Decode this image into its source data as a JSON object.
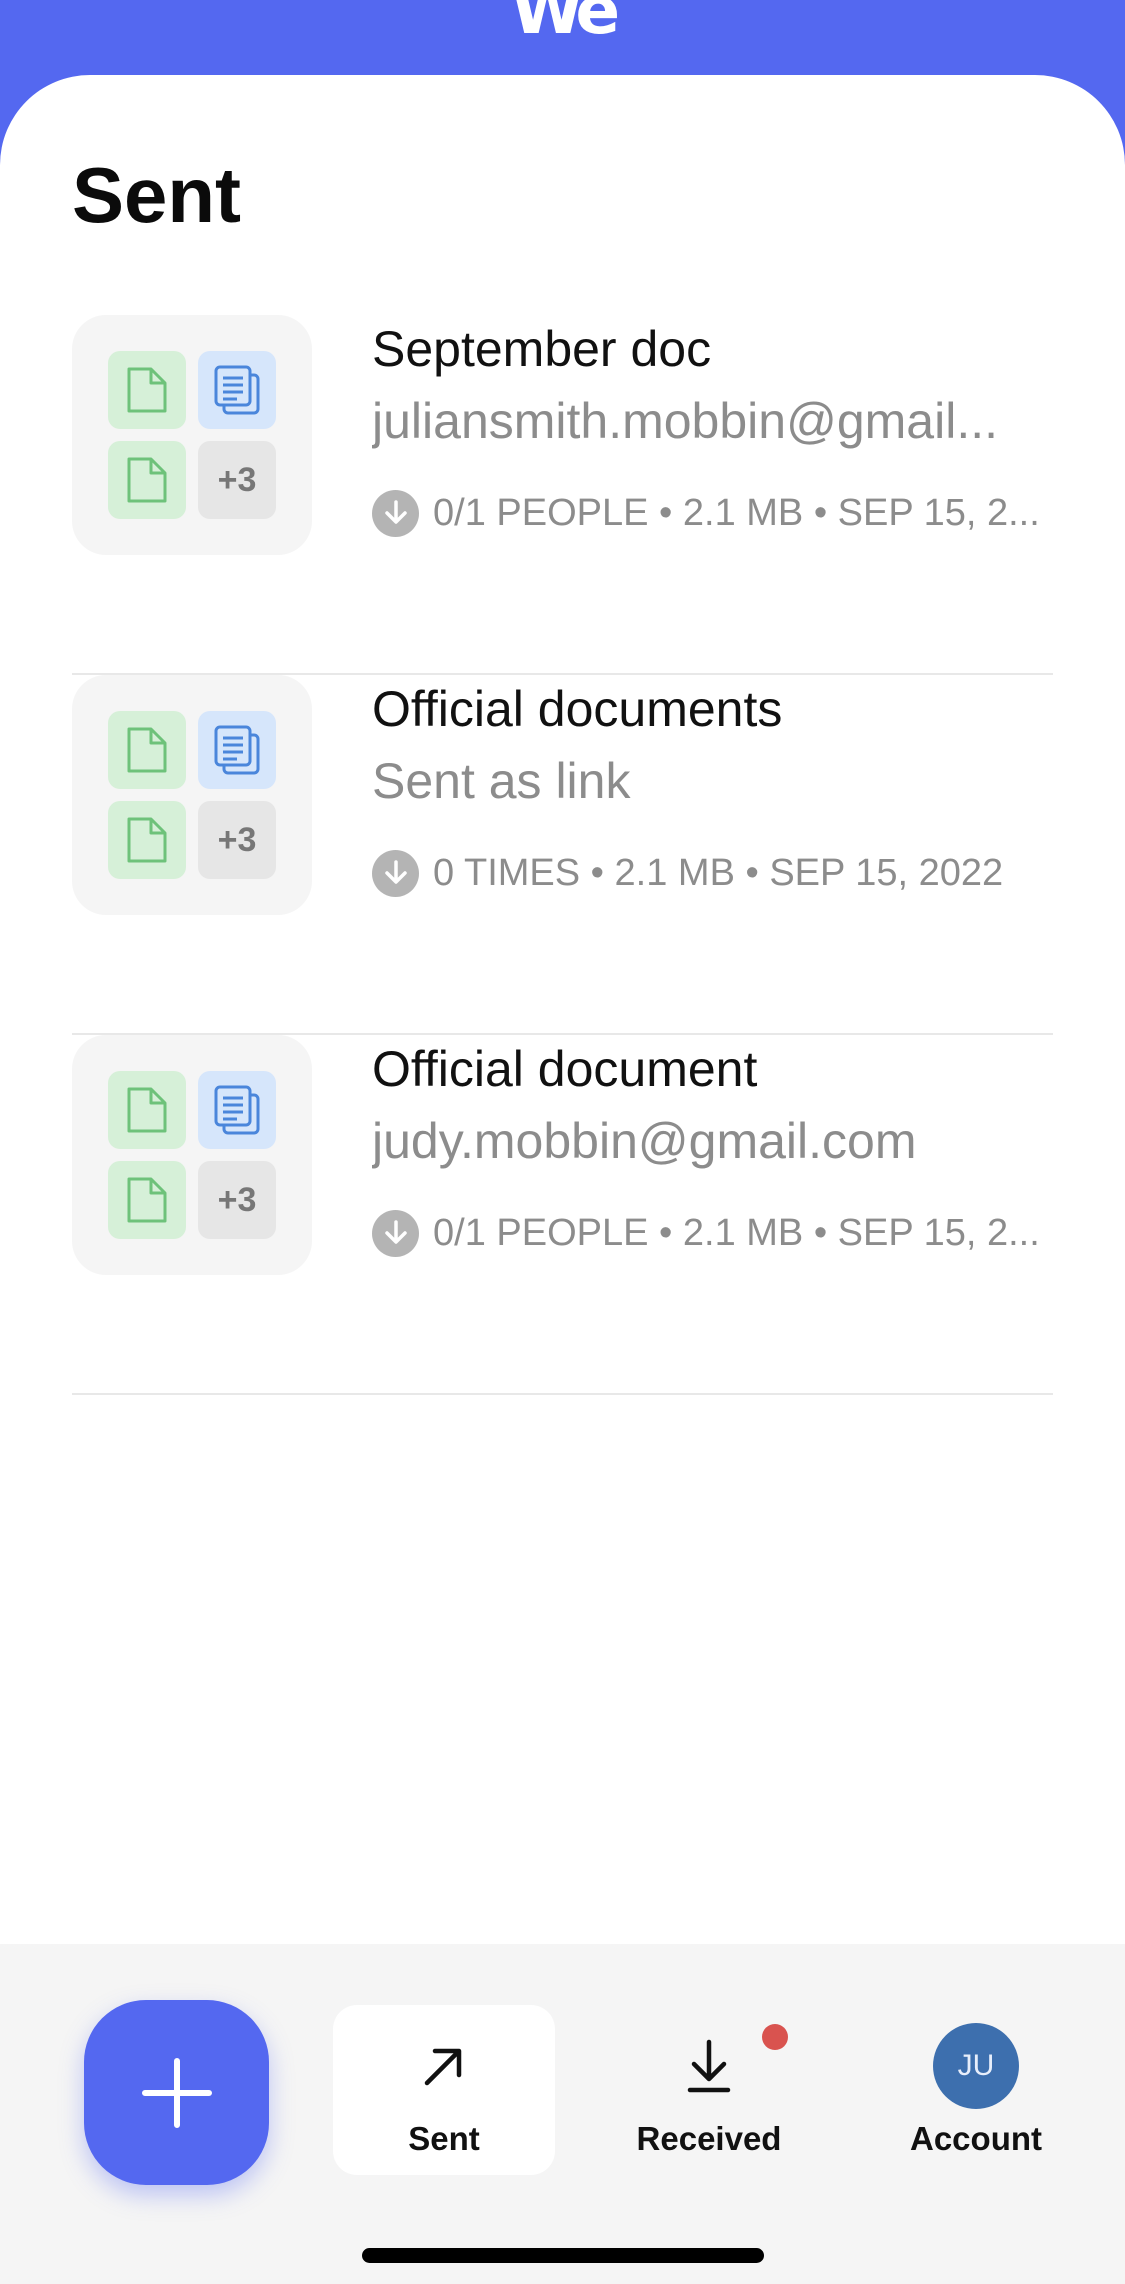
{
  "brand": {
    "logo_text": "We",
    "color": "#5468f0"
  },
  "page": {
    "title": "Sent"
  },
  "transfers": [
    {
      "name": "September doc",
      "recipient": "juliansmith.mobbin@gmail...",
      "meta": "0/1 PEOPLE • 2.1 MB • SEP 15, 2...",
      "thumbnail": {
        "more_label": "+3"
      }
    },
    {
      "name": "Official documents",
      "recipient": "Sent as link",
      "meta": "0 TIMES • 2.1 MB • SEP 15, 2022",
      "thumbnail": {
        "more_label": "+3"
      }
    },
    {
      "name": "Official document",
      "recipient": "judy.mobbin@gmail.com",
      "meta": "0/1 PEOPLE • 2.1 MB • SEP 15, 2...",
      "thumbnail": {
        "more_label": "+3"
      }
    }
  ],
  "nav": {
    "add_icon": "plus-icon",
    "sent": {
      "label": "Sent",
      "icon": "arrow-up-right-icon",
      "active": true
    },
    "received": {
      "label": "Received",
      "icon": "download-icon",
      "has_badge": true,
      "badge_color": "#d9534f"
    },
    "account": {
      "label": "Account",
      "avatar_initials": "JU",
      "avatar_color": "#3d6fae"
    }
  }
}
